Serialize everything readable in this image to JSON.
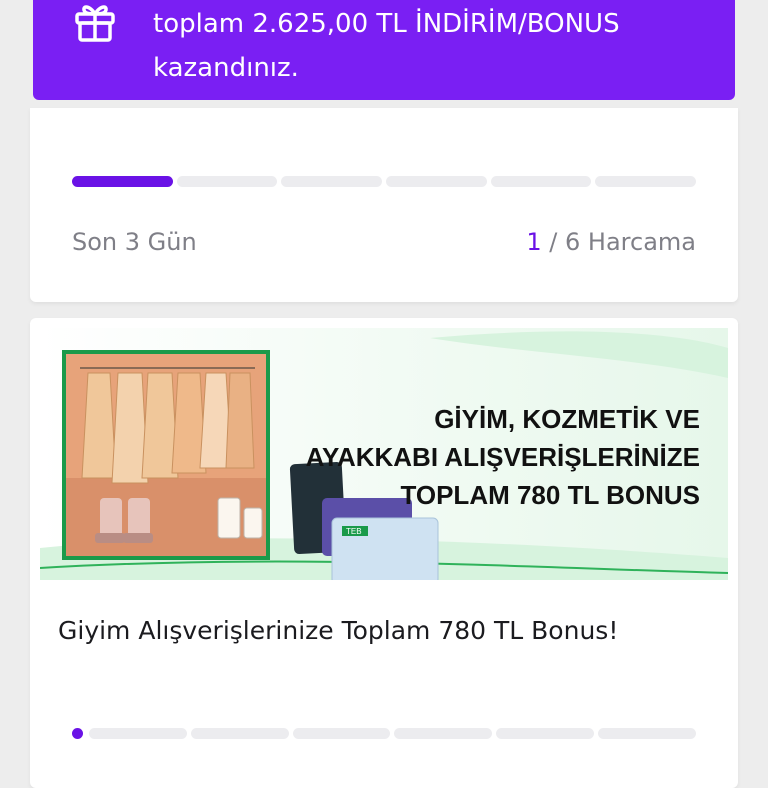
{
  "banner": {
    "icon": "gift-icon",
    "text_line1": "toplam 2.625,00 TL İNDİRİM/BONUS",
    "text_line2": "kazandınız.",
    "bg_color": "#7a1ff3"
  },
  "campaign1": {
    "progress_completed": 1,
    "progress_total": 6,
    "time_left": "Son 3 Gün",
    "count_current": "1",
    "count_rest": " / 6 Harcama"
  },
  "campaign2": {
    "promo_heading_line1": "GİYİM, KOZMETİK VE",
    "promo_heading_line2": "AYAKKABI ALIŞVERİŞLERİNİZE",
    "promo_heading_line3": "TOPLAM 780 TL BONUS",
    "card_label": "TEB",
    "title": "Giyim Alışverişlerinize Toplam 780 TL Bonus!",
    "progress_completed": 0,
    "progress_total": 6
  },
  "colors": {
    "accent": "#6a12e6",
    "track": "#ececef",
    "text_muted": "#7f7f87"
  }
}
